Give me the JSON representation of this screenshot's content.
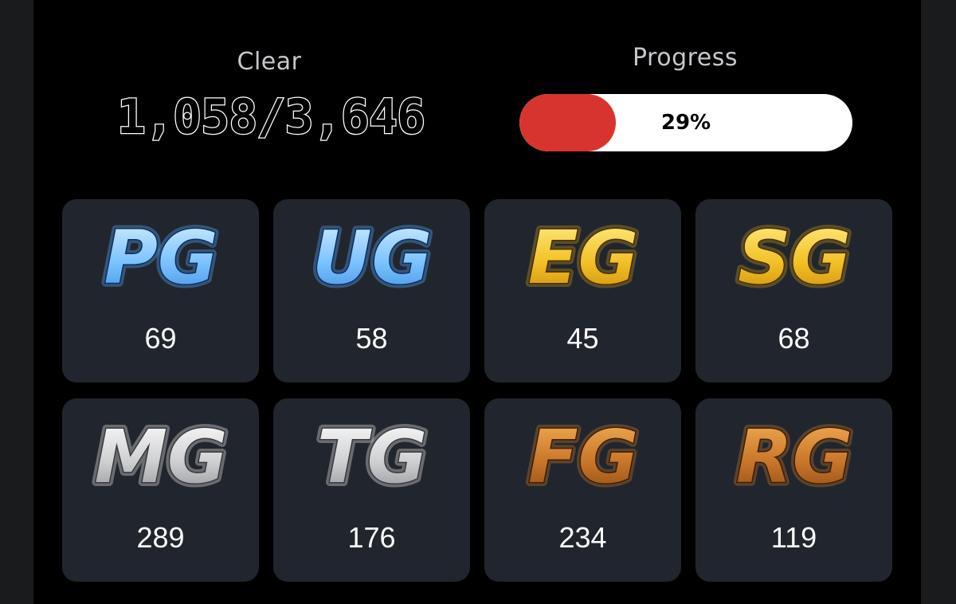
{
  "clear": {
    "label": "Clear",
    "value": "1,058/3,646"
  },
  "progress": {
    "label": "Progress",
    "percent_text": "29%",
    "fraction": 0.29,
    "fill_color": "#d8342f"
  },
  "grades": [
    {
      "code": "PG",
      "count": "69",
      "icon": "pg-grade-icon",
      "tier": "blue"
    },
    {
      "code": "UG",
      "count": "58",
      "icon": "ug-grade-icon",
      "tier": "blue"
    },
    {
      "code": "EG",
      "count": "45",
      "icon": "eg-grade-icon",
      "tier": "gold"
    },
    {
      "code": "SG",
      "count": "68",
      "icon": "sg-grade-icon",
      "tier": "gold"
    },
    {
      "code": "MG",
      "count": "289",
      "icon": "mg-grade-icon",
      "tier": "silver"
    },
    {
      "code": "TG",
      "count": "176",
      "icon": "tg-grade-icon",
      "tier": "silver"
    },
    {
      "code": "FG",
      "count": "234",
      "icon": "fg-grade-icon",
      "tier": "bronze"
    },
    {
      "code": "RG",
      "count": "119",
      "icon": "rg-grade-icon",
      "tier": "bronze"
    }
  ],
  "colors": {
    "background": "#000000",
    "card": "#21252d",
    "blue_top": "#d7f0ff",
    "blue_bottom": "#3d8fe0",
    "gold_top": "#fff08a",
    "gold_bottom": "#c98a0b",
    "silver_top": "#ffffff",
    "silver_bottom": "#8d8f93",
    "bronze_top": "#f6b257",
    "bronze_bottom": "#8a4a14"
  }
}
